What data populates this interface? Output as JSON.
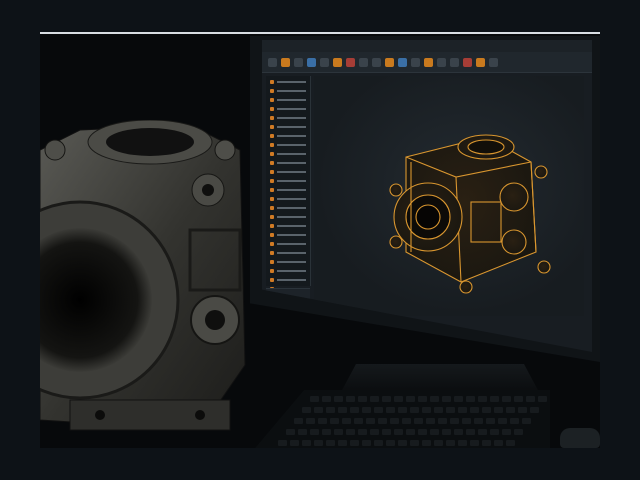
{
  "scene": {
    "description_free": true,
    "accent_color": "#e0a23a",
    "metal_color": "#3a3b38"
  },
  "cad_app": {
    "menu_items": [
      "",
      "",
      "",
      "",
      "",
      ""
    ],
    "toolbar_tool_count": 18,
    "tree_row_count": 24
  },
  "icons": {
    "tools": [
      "tool-icon"
    ],
    "tree": [
      "part-icon"
    ]
  }
}
